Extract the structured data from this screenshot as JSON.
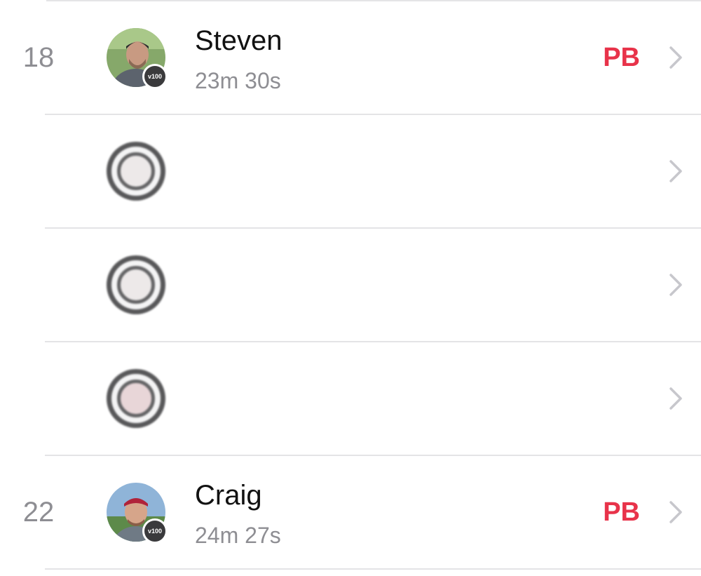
{
  "rows": [
    {
      "position": "18",
      "name": "Steven",
      "time": "23m 30s",
      "badge": "v100",
      "pb": "PB"
    },
    {
      "position": "",
      "name": "",
      "time": "",
      "badge": "",
      "pb": ""
    },
    {
      "position": "",
      "name": "",
      "time": "",
      "badge": "",
      "pb": ""
    },
    {
      "position": "",
      "name": "",
      "time": "",
      "badge": "",
      "pb": ""
    },
    {
      "position": "22",
      "name": "Craig",
      "time": "24m 27s",
      "badge": "v100",
      "pb": "PB"
    }
  ],
  "colors": {
    "pb": "#e8334a",
    "secondary": "#8e8e93",
    "divider": "#e4e4e6"
  },
  "icons": {
    "chevron": "chevron-right-icon",
    "placeholder": "default-avatar-icon"
  }
}
